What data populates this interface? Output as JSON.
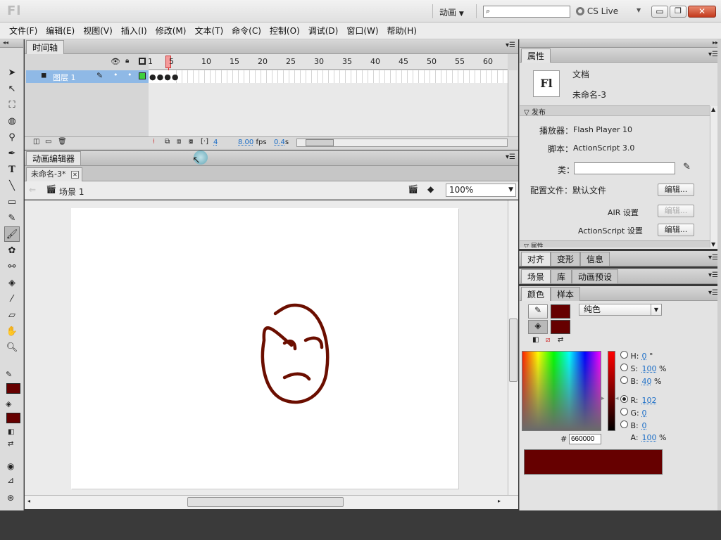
{
  "app": {
    "logo": "Fl",
    "workspace": "动画",
    "search_placeholder": "",
    "cs_live": "CS Live"
  },
  "menu": [
    "文件(F)",
    "编辑(E)",
    "视图(V)",
    "插入(I)",
    "修改(M)",
    "文本(T)",
    "命令(C)",
    "控制(O)",
    "调试(D)",
    "窗口(W)",
    "帮助(H)"
  ],
  "timeline": {
    "tab": "时间轴",
    "layer_name": "图层 1",
    "frame_numbers": [
      "1",
      "5",
      "10",
      "15",
      "20",
      "25",
      "30",
      "35",
      "40",
      "45",
      "50",
      "55",
      "60"
    ],
    "current_frame": "4",
    "fps": "8.00",
    "fps_unit": "fps",
    "time": "0.4",
    "time_unit": "s"
  },
  "motion_editor_tab": "动画编辑器",
  "document_tab": "未命名-3*",
  "scene": {
    "label": "场景 1",
    "zoom": "100%"
  },
  "properties": {
    "tab": "属性",
    "doc_type": "文档",
    "doc_name": "未命名-3",
    "publish_section": "发布",
    "player_label": "播放器：",
    "player_value": "Flash Player 10",
    "script_label": "脚本：",
    "script_value": "ActionScript 3.0",
    "class_label": "类：",
    "class_value": "",
    "profile_label": "配置文件：",
    "profile_value": "默认文件",
    "edit_label": "编辑...",
    "air_label": "AIR 设置",
    "as_label": "ActionScript 设置",
    "props_section": "属性"
  },
  "panels": {
    "row1": [
      "对齐",
      "变形",
      "信息"
    ],
    "row2": [
      "场景",
      "库",
      "动画预设"
    ],
    "row3": [
      "颜色",
      "样本"
    ]
  },
  "color": {
    "fill_type": "纯色",
    "h_label": "H:",
    "h_value": "0",
    "h_unit": "°",
    "s_label": "S:",
    "s_value": "100",
    "s_unit": "%",
    "b_label": "B:",
    "b_value": "40",
    "b_unit": "%",
    "r_label": "R:",
    "r_value": "102",
    "g_label": "G:",
    "g_value": "0",
    "bl_label": "B:",
    "bl_value": "0",
    "a_label": "A:",
    "a_value": "100",
    "a_unit": "%",
    "hex_label": "#",
    "hex_value": "660000",
    "swatch_color": "#660000"
  },
  "colors": {
    "accent_blue": "#8fb9e6",
    "playhead": "#e02020",
    "stroke": "#6b0e00"
  }
}
